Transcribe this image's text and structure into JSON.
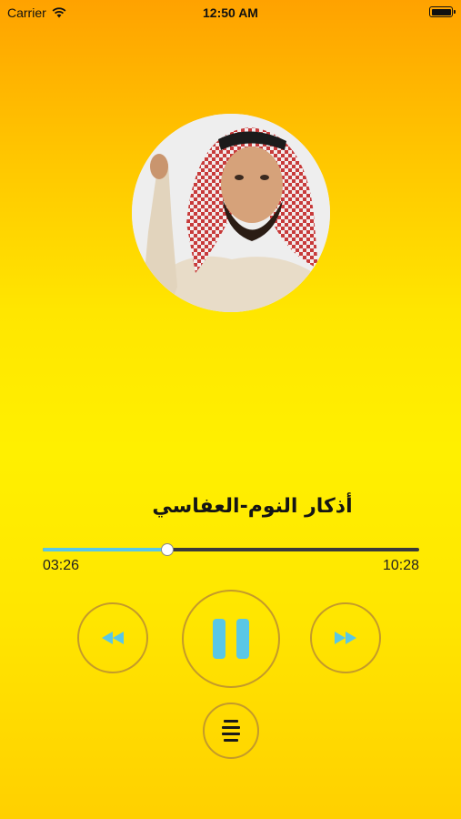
{
  "status_bar": {
    "carrier": "Carrier",
    "time": "12:50 AM",
    "icons": [
      "wifi-icon",
      "battery-icon"
    ]
  },
  "player": {
    "artwork": "reciter-portrait",
    "title": "أذكار النوم-العفاسي",
    "elapsed": "03:26",
    "total": "10:28",
    "progress_fraction": 0.33,
    "colors": {
      "accent": "#59c7e6",
      "track": "#3a3a3a",
      "button_ring": "#c49a2a"
    }
  },
  "controls": {
    "rewind_icon": "rewind-icon",
    "pause_icon": "pause-icon",
    "forward_icon": "fast-forward-icon",
    "playlist_icon": "list-icon"
  }
}
